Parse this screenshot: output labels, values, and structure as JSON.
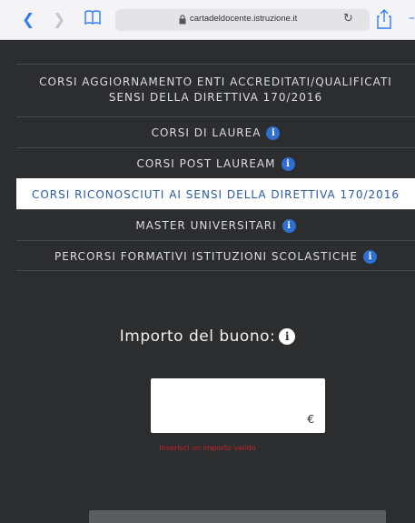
{
  "browser": {
    "url": "cartadeldocente.istruzione.it",
    "colors": {
      "accent": "#2f7cf6"
    },
    "icons": [
      "chevron-left-icon",
      "chevron-right-icon",
      "book-icon",
      "lock-icon",
      "reload-icon",
      "share-icon"
    ]
  },
  "course_menu": {
    "items": [
      {
        "label_line1": "CORSI AGGIORNAMENTO ENTI ACCREDITATI/QUALIFICATI",
        "label_line2": "SENSI DELLA DIRETTIVA 170/2016",
        "info": false,
        "selected": false
      },
      {
        "label": "CORSI DI LAUREA",
        "info": true,
        "selected": false
      },
      {
        "label": "CORSI POST LAUREAM",
        "info": true,
        "selected": false
      },
      {
        "label": "CORSI RICONOSCIUTI AI SENSI DELLA DIRETTIVA 170/2016",
        "info": false,
        "selected": true
      },
      {
        "label": "MASTER UNIVERSITARI",
        "info": true,
        "selected": false
      },
      {
        "label": "PERCORSI FORMATIVI ISTITUZIONI SCOLASTICHE",
        "info": true,
        "selected": false
      }
    ],
    "info_glyph": "i"
  },
  "form": {
    "amount_label": "Importo del buono:",
    "amount_value": "",
    "currency_symbol": "€",
    "error_text": "Inserisci un importo valido",
    "colors": {
      "error": "#c8232c",
      "background": "#2c2d2f",
      "info_badge": "#2e6fd1"
    }
  }
}
